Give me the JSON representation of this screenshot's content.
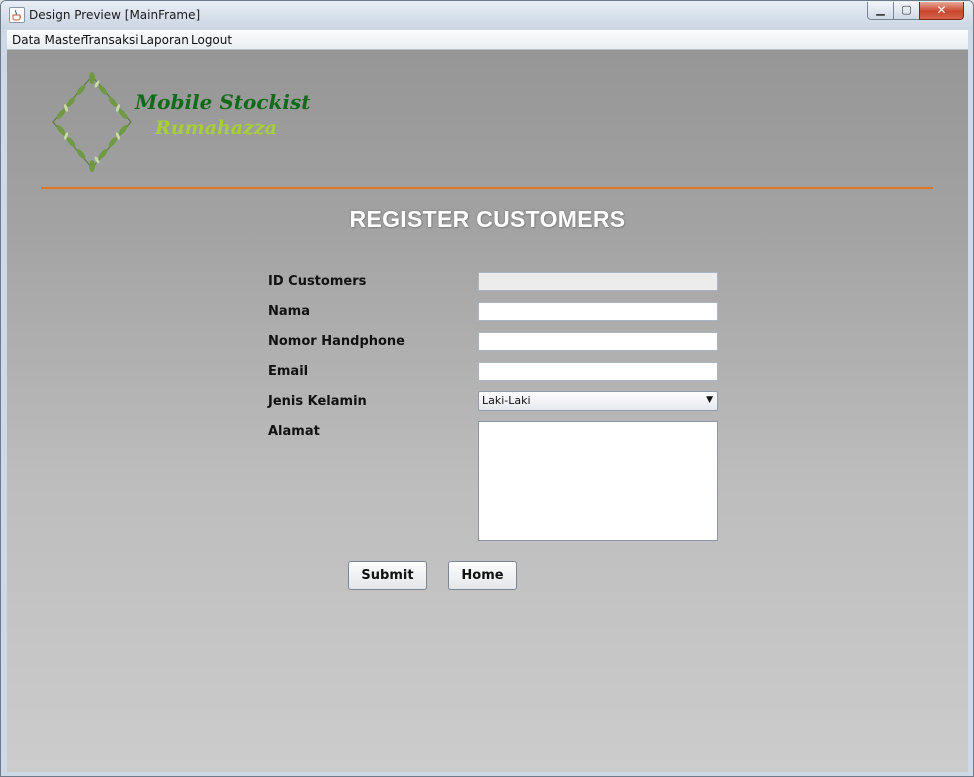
{
  "window": {
    "title": "Design Preview [MainFrame]"
  },
  "menu": [
    "Data Master",
    "Transaksi",
    "Laporan",
    "Logout"
  ],
  "brand": {
    "line1": "Mobile Stockist",
    "line2": "Rumahazza"
  },
  "page_title": "REGISTER CUSTOMERS",
  "form": {
    "id_label": "ID Customers",
    "id_value": "",
    "nama_label": "Nama",
    "nama_value": "",
    "hp_label": "Nomor Handphone",
    "hp_value": "",
    "email_label": "Email",
    "email_value": "",
    "gender_label": "Jenis Kelamin",
    "gender_value": "Laki-Laki",
    "alamat_label": "Alamat",
    "alamat_value": ""
  },
  "buttons": {
    "submit": "Submit",
    "home": "Home"
  },
  "colors": {
    "brand_green": "#0f6b18",
    "brand_lime": "#a6cf38",
    "divider": "#e0761f"
  },
  "icons": {
    "app": "java-cup-icon",
    "logo": "leaf-wreath-icon"
  }
}
